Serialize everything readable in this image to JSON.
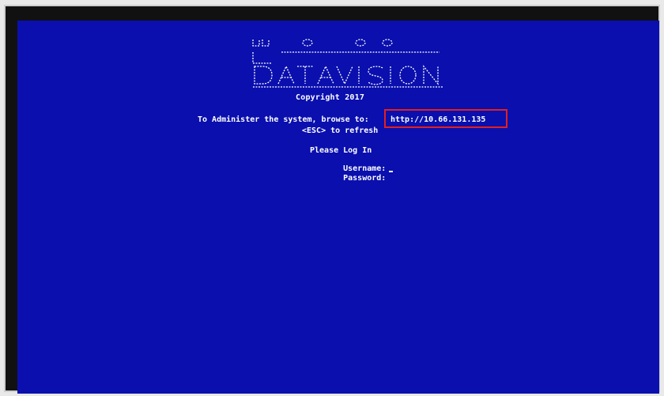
{
  "console": {
    "logo_text": "Datavision",
    "copyright": "Copyright 2017",
    "admin_prompt": "To Administer the system, browse to:",
    "admin_url": "http://10.66.131.135",
    "refresh_hint": "<ESC> to refresh",
    "login_title": "Please Log In",
    "username_label": "Username:",
    "password_label": "Password:"
  },
  "colors": {
    "screen_background": "#0a0fae",
    "text": "#ffffff",
    "highlight_box": "#e2201f"
  }
}
